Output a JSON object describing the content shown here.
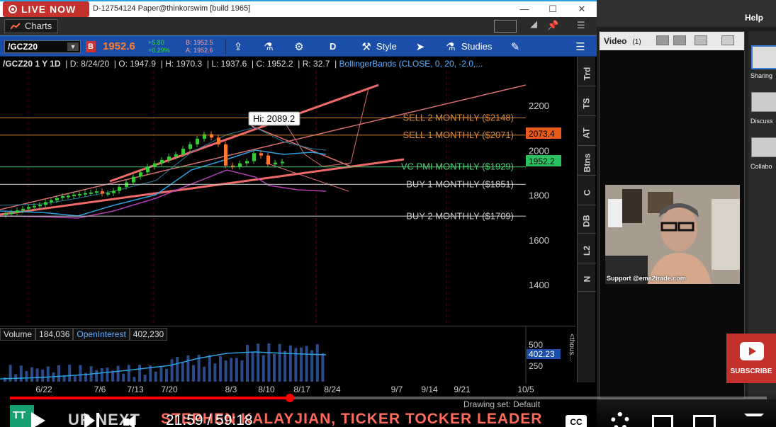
{
  "live_badge": "LIVE NOW",
  "window": {
    "title": "D-12754124 Paper@thinkorswim [build 1965]"
  },
  "menubar": {
    "tab": "Charts"
  },
  "toolbar": {
    "symbol": "/GCZ20",
    "b_badge": "B",
    "last": "1952.6",
    "change": "+5.80",
    "change_pct": "+0.29%",
    "bid": "B: 1952.5",
    "ask": "A: 1952.6",
    "period": "D",
    "style": "Style",
    "studies": "Studies"
  },
  "info": {
    "symbol": "/GCZ20 1 Y 1D",
    "date": "D: 8/24/20",
    "open": "O: 1947.9",
    "high": "H: 1970.3",
    "low": "L: 1937.6",
    "close": "C: 1952.2",
    "range": "R: 32.7",
    "study": "BollingerBands (CLOSE, 0, 20, -2.0,..."
  },
  "chart": {
    "hi_label": "Hi: 2089.2",
    "levels": [
      {
        "label": "SELL 2 MONTHLY ($2148)",
        "price": 2148,
        "color": "#d88a3a"
      },
      {
        "label": "SELL 1 MONTHLY ($2071)",
        "price": 2071,
        "color": "#d88a3a"
      },
      {
        "label": "VC PMI MONTHLY ($1929)",
        "price": 1929,
        "color": "#4fd17a"
      },
      {
        "label": "BUY 1 MONTHLY ($1851)",
        "price": 1851,
        "color": "#c8c8c8"
      },
      {
        "label": "BUY 2 MONTHLY ($1709)",
        "price": 1709,
        "color": "#c8c8c8"
      }
    ],
    "y_ticks": [
      "2200",
      "2000",
      "1800",
      "1600",
      "1400"
    ],
    "badge_orange": "2073.4",
    "badge_green": "1952.2",
    "x_ticks": [
      "6/22",
      "7/6",
      "7/13",
      "7/20",
      "8/3",
      "8/10",
      "8/17",
      "8/24",
      "9/7",
      "9/14",
      "9/21",
      "10/5"
    ]
  },
  "volume": {
    "label": "Volume",
    "value": "184,036",
    "oi_label": "OpenInterest",
    "oi_value": "402,230",
    "badge": "402.23",
    "ticks": [
      "500",
      "250"
    ],
    "unit": "<thous..."
  },
  "side_tabs": [
    "Trd",
    "TS",
    "AT",
    "Btns",
    "C",
    "DB",
    "L2",
    "N"
  ],
  "right_panel": {
    "help": "Help",
    "video_title": "Video",
    "video_count": "(1)",
    "cam_caption": "Support @ema2trade.com",
    "share_labels": [
      "Sharing",
      "Discuss",
      "Collabo"
    ]
  },
  "subscribe": "SUBSCRIBE",
  "player": {
    "up_next": "UP NEXT",
    "up_next_title": "STEPHEN KALAYJIAN, TICKER TOCKER LEADER",
    "time": "21:59 / 59:18",
    "progress_fraction": 0.37,
    "drawing_set": "Drawing set: Default",
    "cc": "CC",
    "tt_logo": "TT"
  },
  "colors": {
    "toolbar_blue": "#1a4ea8",
    "youtube_red": "#c4302b",
    "accent_orange": "#ff7a2f"
  }
}
